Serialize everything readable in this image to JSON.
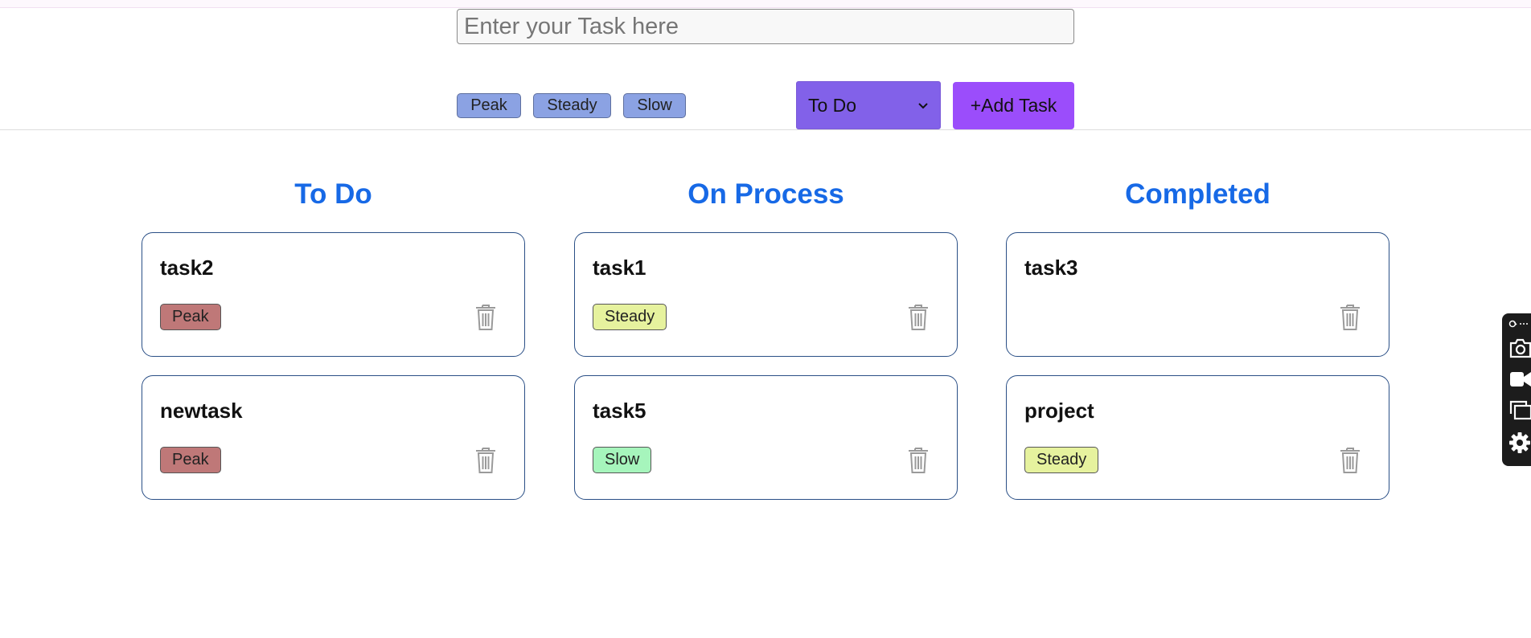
{
  "form": {
    "task_placeholder": "Enter your Task here",
    "priority_buttons": [
      "Peak",
      "Steady",
      "Slow"
    ],
    "status_select": "To Do",
    "add_button": "+Add Task"
  },
  "columns": [
    {
      "title": "To Do",
      "cards": [
        {
          "title": "task2",
          "tag": "Peak"
        },
        {
          "title": "newtask",
          "tag": "Peak"
        }
      ]
    },
    {
      "title": "On Process",
      "cards": [
        {
          "title": "task1",
          "tag": "Steady"
        },
        {
          "title": "task5",
          "tag": "Slow"
        }
      ]
    },
    {
      "title": "Completed",
      "cards": [
        {
          "title": "task3",
          "tag": ""
        },
        {
          "title": "project",
          "tag": "Steady"
        }
      ]
    }
  ],
  "colors": {
    "accent_heading": "#1769e6",
    "add_button": "#9b4dfb",
    "select_bg": "#8261e9",
    "tag_peak": "#bf7878",
    "tag_steady": "#e6f29e",
    "tag_slow": "#a6f5bc"
  },
  "icons": {
    "delete": "trash-icon",
    "toolbar": [
      "link-icon",
      "camera-icon",
      "video-icon",
      "windows-icon",
      "gear-icon"
    ]
  }
}
